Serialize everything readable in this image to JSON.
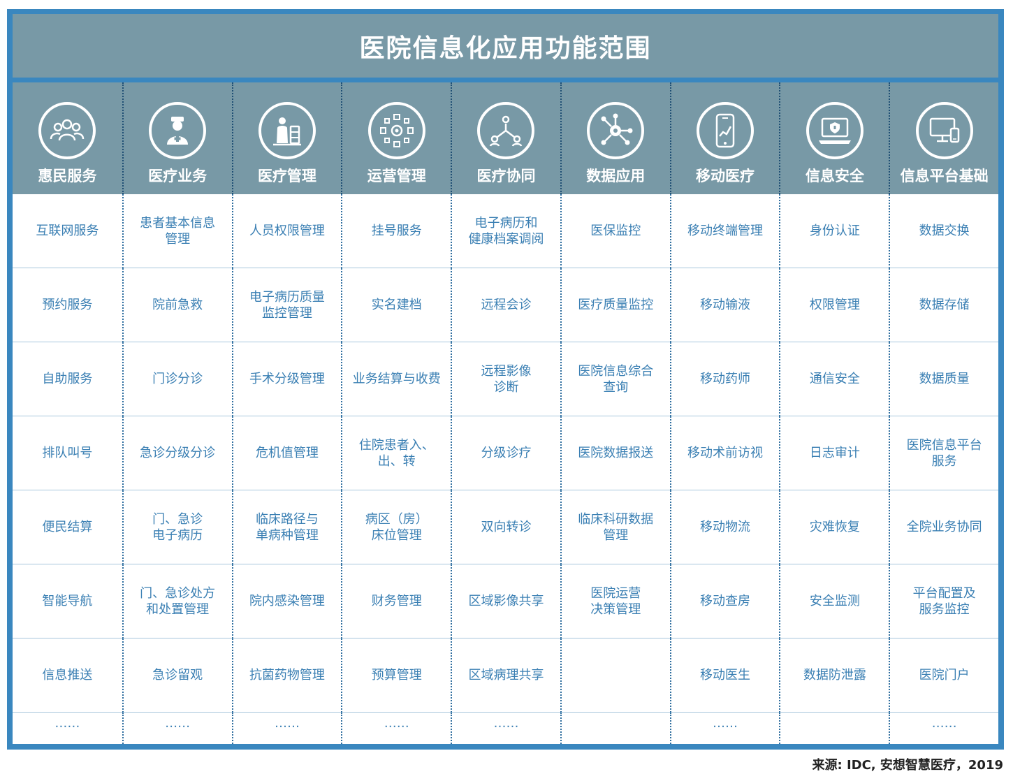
{
  "title": "医院信息化应用功能范围",
  "source": "来源: IDC, 安想智慧医疗，2019",
  "columns": [
    {
      "header": "惠民服务",
      "icon": "people-group-icon",
      "items": [
        "互联网服务",
        "预约服务",
        "自助服务",
        "排队叫号",
        "便民结算",
        "智能导航",
        "信息推送",
        "……"
      ]
    },
    {
      "header": "医疗业务",
      "icon": "doctor-icon",
      "items": [
        "患者基本信息\n管理",
        "院前急救",
        "门诊分诊",
        "急诊分级分诊",
        "门、急诊\n电子病历",
        "门、急诊处方\n和处置管理",
        "急诊留观",
        "……"
      ]
    },
    {
      "header": "医疗管理",
      "icon": "medical-staff-icon",
      "items": [
        "人员权限管理",
        "电子病历质量\n监控管理",
        "手术分级管理",
        "危机值管理",
        "临床路径与\n单病种管理",
        "院内感染管理",
        "抗菌药物管理",
        "……"
      ]
    },
    {
      "header": "运营管理",
      "icon": "gear-network-icon",
      "items": [
        "挂号服务",
        "实名建档",
        "业务结算与收费",
        "住院患者入、\n出、转",
        "病区（房）\n床位管理",
        "财务管理",
        "预算管理",
        "……"
      ]
    },
    {
      "header": "医疗协同",
      "icon": "collaboration-icon",
      "items": [
        "电子病历和\n健康档案调阅",
        "远程会诊",
        "远程影像\n诊断",
        "分级诊疗",
        "双向转诊",
        "区域影像共享",
        "区域病理共享",
        "……"
      ]
    },
    {
      "header": "数据应用",
      "icon": "data-hub-icon",
      "items": [
        "医保监控",
        "医疗质量监控",
        "医院信息综合\n查询",
        "医院数据报送",
        "临床科研数据\n管理",
        "医院运营\n决策管理",
        "",
        ""
      ]
    },
    {
      "header": "移动医疗",
      "icon": "mobile-phone-icon",
      "items": [
        "移动终端管理",
        "移动输液",
        "移动药师",
        "移动术前访视",
        "移动物流",
        "移动查房",
        "移动医生",
        "……"
      ]
    },
    {
      "header": "信息安全",
      "icon": "laptop-shield-icon",
      "items": [
        "身份认证",
        "权限管理",
        "通信安全",
        "日志审计",
        "灾难恢复",
        "安全监测",
        "数据防泄露",
        ""
      ]
    },
    {
      "header": "信息平台基础",
      "icon": "devices-icon",
      "items": [
        "数据交换",
        "数据存储",
        "数据质量",
        "医院信息平台\n服务",
        "全院业务协同",
        "平台配置及\n服务监控",
        "医院门户",
        "……"
      ]
    }
  ],
  "colors": {
    "frame": "#3a87bf",
    "header": "#7899a6",
    "text": "#3a7fb3"
  }
}
